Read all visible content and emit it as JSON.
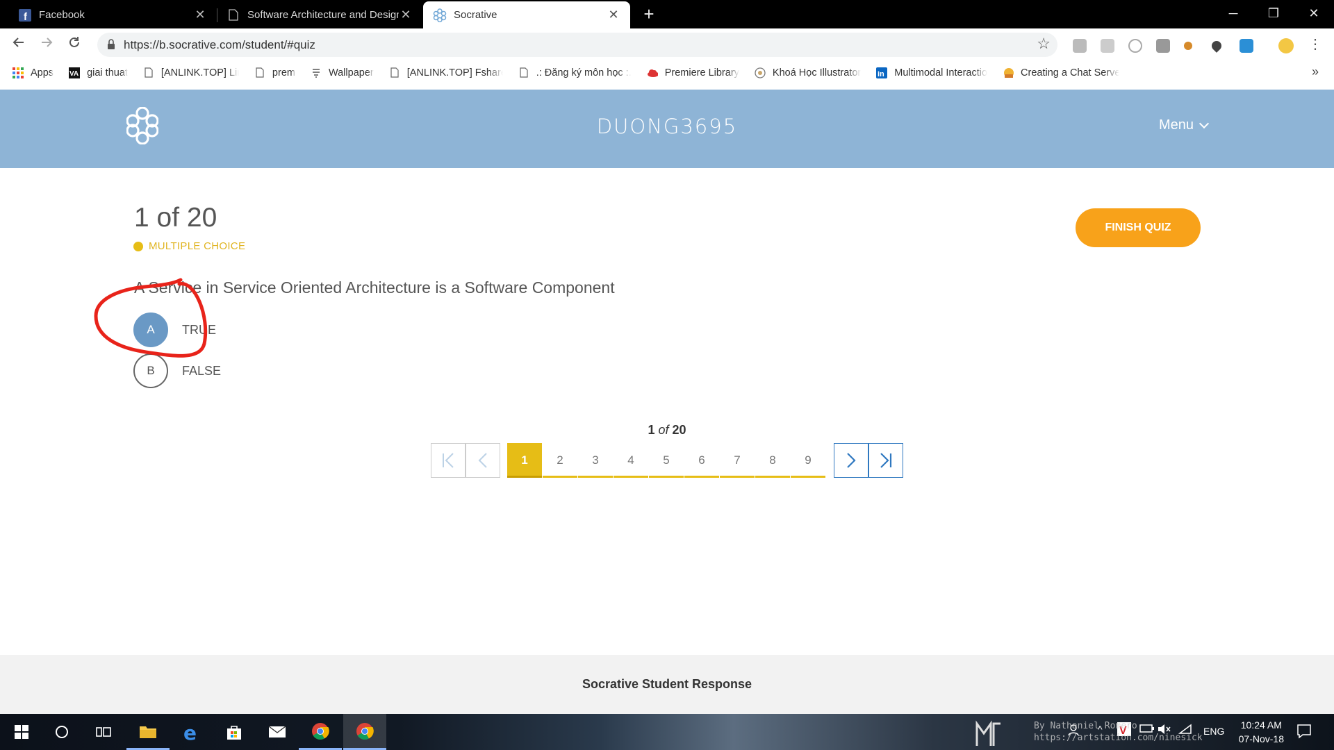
{
  "browser": {
    "tabs": [
      {
        "title": "Facebook",
        "icon": "facebook-icon"
      },
      {
        "title": "Software Architecture and Design",
        "icon": "page-icon"
      },
      {
        "title": "Socrative",
        "icon": "socrative-icon"
      }
    ],
    "url": "https://b.socrative.com/student/#quiz",
    "bookmarks": [
      {
        "label": "Apps"
      },
      {
        "label": "giai thuat"
      },
      {
        "label": "[ANLINK.TOP] Link Pr"
      },
      {
        "label": "prem"
      },
      {
        "label": "Wallpaper"
      },
      {
        "label": "[ANLINK.TOP] Fshare"
      },
      {
        "label": ".: Đăng ký môn học :."
      },
      {
        "label": "Premiere Library"
      },
      {
        "label": "Khoá Học Illustrator"
      },
      {
        "label": "Multimodal Interactio"
      },
      {
        "label": "Creating a Chat Serve"
      }
    ],
    "bookmarks_more": "»"
  },
  "app": {
    "room": "DUONG3695",
    "menu_label": "Menu"
  },
  "quiz": {
    "progress": "1 of 20",
    "type_label": "MULTIPLE CHOICE",
    "finish_label": "FINISH QUIZ",
    "question": "A Service in Service Oriented Architecture is a Software Component",
    "answers": [
      {
        "letter": "A",
        "text": "TRUE",
        "selected": true
      },
      {
        "letter": "B",
        "text": "FALSE",
        "selected": false
      }
    ],
    "pager": {
      "current": "1",
      "of_word": "of",
      "total": "20",
      "pages": [
        "1",
        "2",
        "3",
        "4",
        "5",
        "6",
        "7",
        "8",
        "9"
      ]
    }
  },
  "footer": {
    "text": "Socrative Student Response"
  },
  "taskbar": {
    "lang": "ENG",
    "time": "10:24 AM",
    "date": "07-Nov-18",
    "watermark_line1": "By Nathaniel Romero",
    "watermark_line2": "https://artstation.com/ninesick"
  },
  "colors": {
    "header_blue": "#8eb4d6",
    "accent_yellow": "#e6bd16",
    "finish_orange": "#f8a21a",
    "selected_blue": "#6a99c5",
    "annotation_red": "#e8231a"
  }
}
